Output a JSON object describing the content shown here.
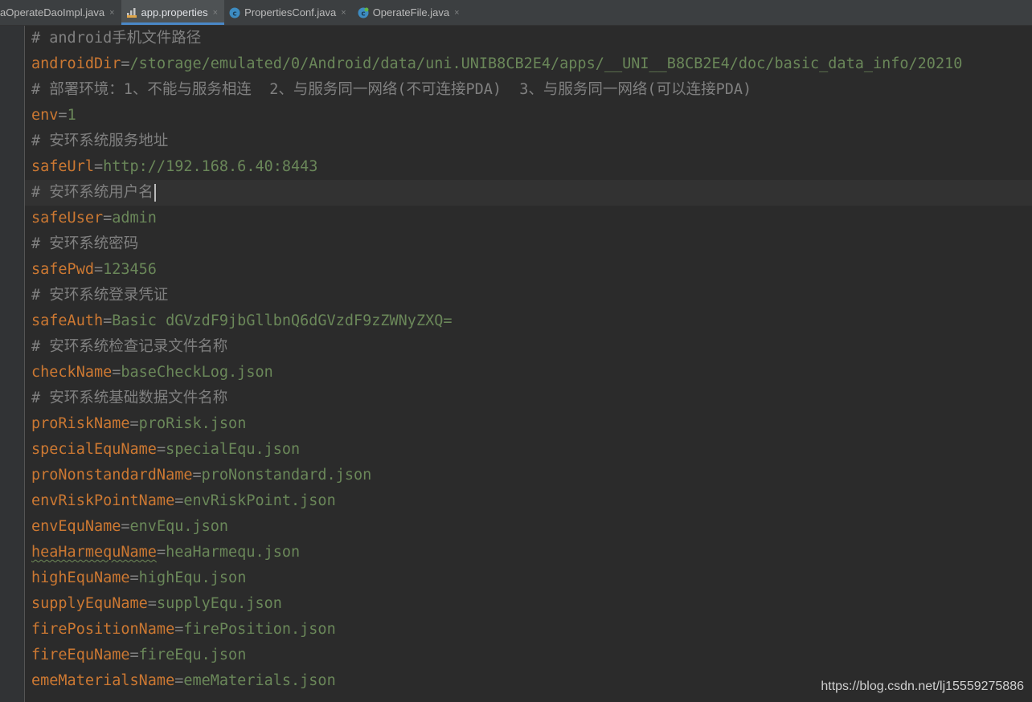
{
  "tabs": [
    {
      "label": "aOperateDaoImpl.java",
      "icon": "none",
      "active": false
    },
    {
      "label": "app.properties",
      "icon": "properties-file-icon",
      "active": true
    },
    {
      "label": "PropertiesConf.java",
      "icon": "java-class-icon",
      "active": false
    },
    {
      "label": "OperateFile.java",
      "icon": "java-class-icon",
      "active": false
    }
  ],
  "close_glyph": "×",
  "colors": {
    "background": "#2b2b2b",
    "comment": "#808080",
    "key": "#cc7832",
    "value": "#6a8759",
    "tab_accent": "#4a88c7"
  },
  "lines": [
    {
      "type": "comment",
      "text": "# android手机文件路径"
    },
    {
      "type": "property",
      "key": "androidDir",
      "value": "/storage/emulated/0/Android/data/uni.UNIB8CB2E4/apps/__UNI__B8CB2E4/doc/basic_data_info/20210"
    },
    {
      "type": "comment",
      "text": "# 部署环境：1、不能与服务相连  2、与服务同一网络(不可连接PDA)  3、与服务同一网络(可以连接PDA)"
    },
    {
      "type": "property",
      "key": "env",
      "value": "1"
    },
    {
      "type": "comment",
      "text": "# 安环系统服务地址"
    },
    {
      "type": "property",
      "key": "safeUrl",
      "value": "http://192.168.6.40:8443"
    },
    {
      "type": "comment",
      "text": "# 安环系统用户名",
      "caret": true
    },
    {
      "type": "property",
      "key": "safeUser",
      "value": "admin"
    },
    {
      "type": "comment",
      "text": "# 安环系统密码"
    },
    {
      "type": "property",
      "key": "safePwd",
      "value": "123456"
    },
    {
      "type": "comment",
      "text": "# 安环系统登录凭证"
    },
    {
      "type": "property",
      "key": "safeAuth",
      "value": "Basic dGVzdF9jbGllbnQ6dGVzdF9zZWNyZXQ="
    },
    {
      "type": "comment",
      "text": "# 安环系统检查记录文件名称"
    },
    {
      "type": "property",
      "key": "checkName",
      "value": "baseCheckLog.json"
    },
    {
      "type": "comment",
      "text": "# 安环系统基础数据文件名称"
    },
    {
      "type": "property",
      "key": "proRiskName",
      "value": "proRisk.json"
    },
    {
      "type": "property",
      "key": "specialEquName",
      "value": "specialEqu.json"
    },
    {
      "type": "property",
      "key": "proNonstandardName",
      "value": "proNonstandard.json"
    },
    {
      "type": "property",
      "key": "envRiskPointName",
      "value": "envRiskPoint.json"
    },
    {
      "type": "property",
      "key": "envEquName",
      "value": "envEqu.json"
    },
    {
      "type": "property",
      "key": "heaHarmequName",
      "value": "heaHarmequ.json"
    },
    {
      "type": "property",
      "key": "highEquName",
      "value": "highEqu.json"
    },
    {
      "type": "property",
      "key": "supplyEquName",
      "value": "supplyEqu.json"
    },
    {
      "type": "property",
      "key": "firePositionName",
      "value": "firePosition.json"
    },
    {
      "type": "property",
      "key": "fireEquName",
      "value": "fireEqu.json"
    },
    {
      "type": "property",
      "key": "emeMaterialsName",
      "value": "emeMaterials.json"
    }
  ],
  "watermark": "https://blog.csdn.net/lj15559275886"
}
